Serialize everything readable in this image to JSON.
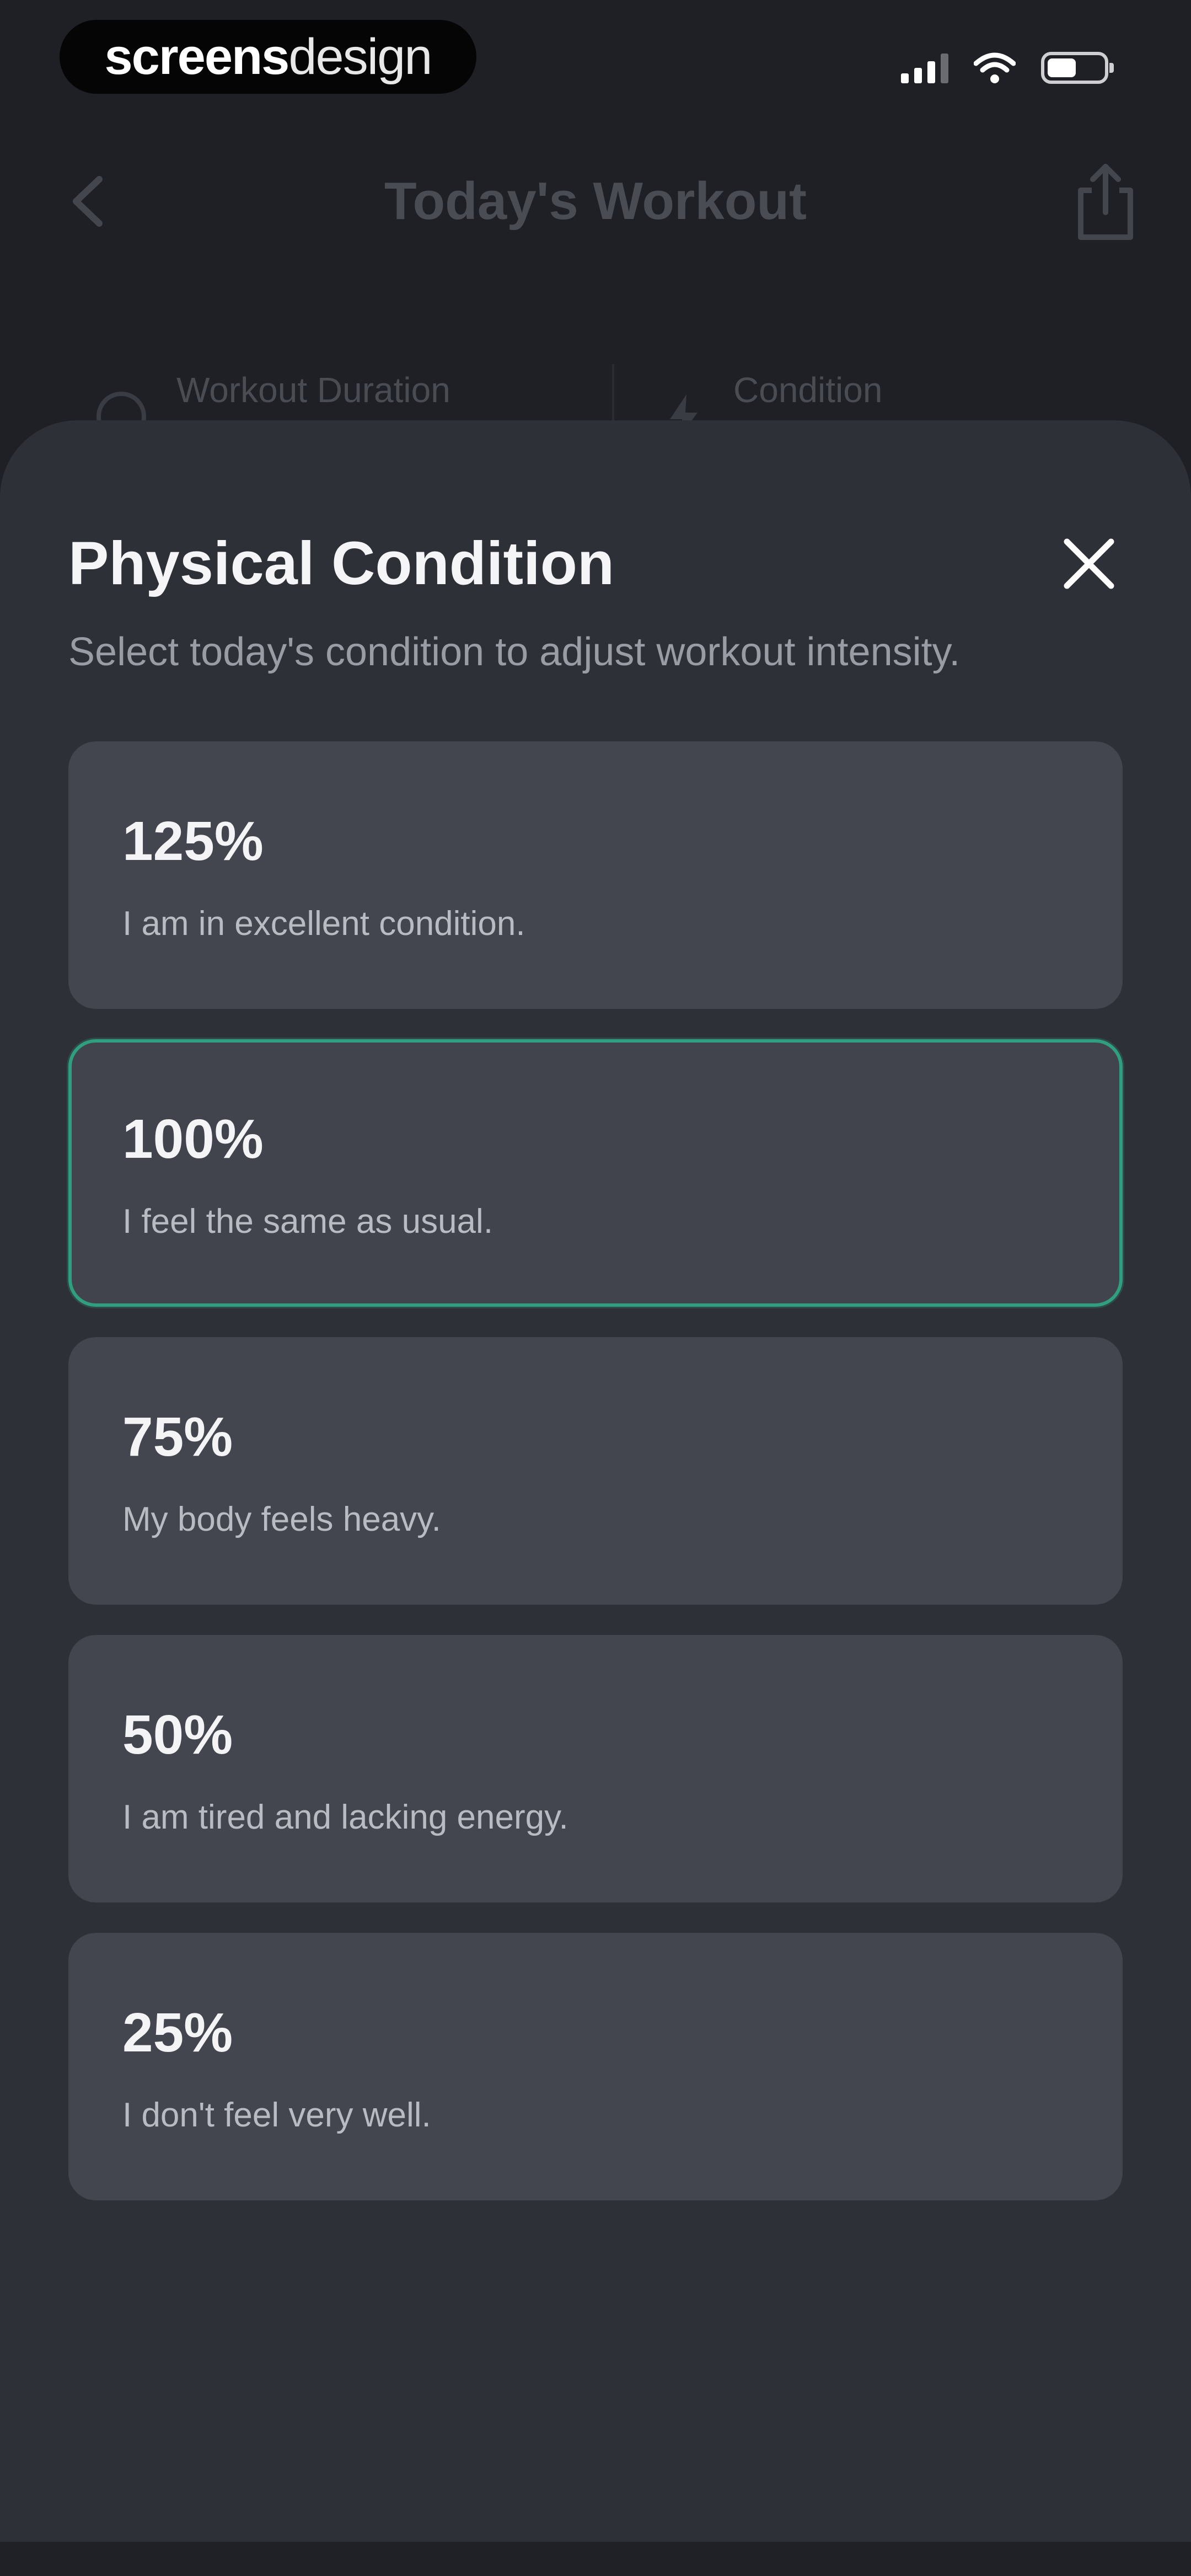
{
  "status_bar": {
    "watermark_bold": "screens",
    "watermark_light": "design"
  },
  "nav": {
    "title": "Today's Workout"
  },
  "summary": {
    "duration_label": "Workout Duration",
    "condition_label": "Condition"
  },
  "sheet": {
    "title": "Physical Condition",
    "subtitle": "Select today's condition to adjust workout intensity.",
    "options": [
      {
        "percent": "125%",
        "description": "I am in excellent condition.",
        "selected": false
      },
      {
        "percent": "100%",
        "description": "I feel the same as usual.",
        "selected": true
      },
      {
        "percent": "75%",
        "description": "My body feels heavy.",
        "selected": false
      },
      {
        "percent": "50%",
        "description": "I am tired and lacking energy.",
        "selected": false
      },
      {
        "percent": "25%",
        "description": "I don't feel very well.",
        "selected": false
      }
    ]
  },
  "colors": {
    "background": "#1e2026",
    "sheet": "#2e3037",
    "card": "#44464f",
    "selected_border": "#2f9f7f",
    "text_primary": "#f5f5f7",
    "text_secondary": "#9a9ca5"
  },
  "icons": {
    "back": "chevron-left-icon",
    "share": "share-icon",
    "close": "close-icon",
    "signal": "signal-icon",
    "wifi": "wifi-icon",
    "battery": "battery-icon",
    "duration": "clock-icon",
    "condition": "bolt-icon"
  },
  "battery_level": 0.46
}
